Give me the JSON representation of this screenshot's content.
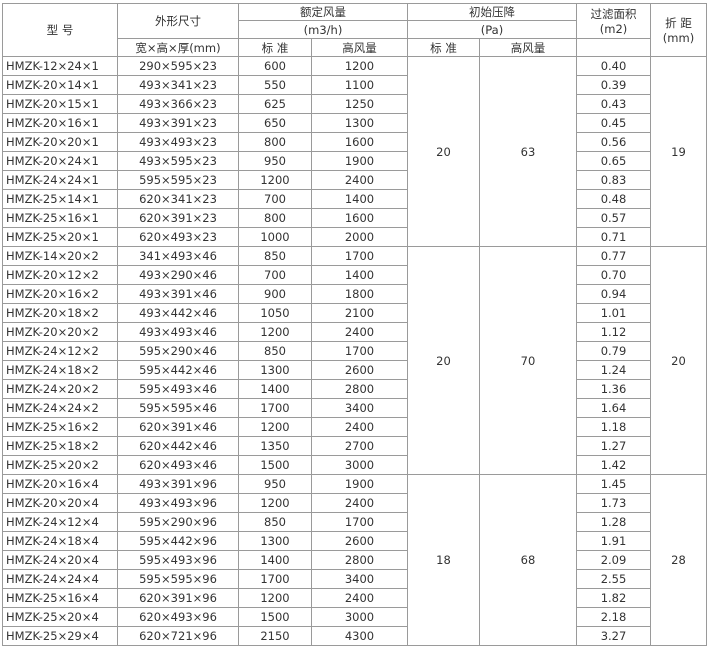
{
  "headers": {
    "model": "型 号",
    "dimensions": "外形尺寸",
    "dimensions_sub": "宽×高×厚(mm)",
    "airflow": "额定风量",
    "airflow_unit": "(m3/h)",
    "pressure": "初始压降",
    "pressure_unit": "(Pa)",
    "standard": "标 准",
    "high_airflow": "高风量",
    "area": "过滤面积",
    "area_unit": "(m2)",
    "pitch": "折 距",
    "pitch_unit": "(mm)"
  },
  "groups": [
    {
      "pressure_std": "20",
      "pressure_high": "63",
      "pitch": "19",
      "rows": [
        {
          "model": "HMZK-12×24×1",
          "size": "290×595×23",
          "std": "600",
          "high": "1200",
          "area": "0.40"
        },
        {
          "model": "HMZK-20×14×1",
          "size": "493×341×23",
          "std": "550",
          "high": "1100",
          "area": "0.39"
        },
        {
          "model": "HMZK-20×15×1",
          "size": "493×366×23",
          "std": "625",
          "high": "1250",
          "area": "0.43"
        },
        {
          "model": "HMZK-20×16×1",
          "size": "493×391×23",
          "std": "650",
          "high": "1300",
          "area": "0.45"
        },
        {
          "model": "HMZK-20×20×1",
          "size": "493×493×23",
          "std": "800",
          "high": "1600",
          "area": "0.56"
        },
        {
          "model": "HMZK-20×24×1",
          "size": "493×595×23",
          "std": "950",
          "high": "1900",
          "area": "0.65"
        },
        {
          "model": "HMZK-24×24×1",
          "size": "595×595×23",
          "std": "1200",
          "high": "2400",
          "area": "0.83"
        },
        {
          "model": "HMZK-25×14×1",
          "size": "620×341×23",
          "std": "700",
          "high": "1400",
          "area": "0.48"
        },
        {
          "model": "HMZK-25×16×1",
          "size": "620×391×23",
          "std": "800",
          "high": "1600",
          "area": "0.57"
        },
        {
          "model": "HMZK-25×20×1",
          "size": "620×493×23",
          "std": "1000",
          "high": "2000",
          "area": "0.71"
        }
      ]
    },
    {
      "pressure_std": "20",
      "pressure_high": "70",
      "pitch": "20",
      "rows": [
        {
          "model": "HMZK-14×20×2",
          "size": "341×493×46",
          "std": "850",
          "high": "1700",
          "area": "0.77"
        },
        {
          "model": "HMZK-20×12×2",
          "size": "493×290×46",
          "std": "700",
          "high": "1400",
          "area": "0.70"
        },
        {
          "model": "HMZK-20×16×2",
          "size": "493×391×46",
          "std": "900",
          "high": "1800",
          "area": "0.94"
        },
        {
          "model": "HMZK-20×18×2",
          "size": "493×442×46",
          "std": "1050",
          "high": "2100",
          "area": "1.01"
        },
        {
          "model": "HMZK-20×20×2",
          "size": "493×493×46",
          "std": "1200",
          "high": "2400",
          "area": "1.12"
        },
        {
          "model": "HMZK-24×12×2",
          "size": "595×290×46",
          "std": "850",
          "high": "1700",
          "area": "0.79"
        },
        {
          "model": "HMZK-24×18×2",
          "size": "595×442×46",
          "std": "1300",
          "high": "2600",
          "area": "1.24"
        },
        {
          "model": "HMZK-24×20×2",
          "size": "595×493×46",
          "std": "1400",
          "high": "2800",
          "area": "1.36"
        },
        {
          "model": "HMZK-24×24×2",
          "size": "595×595×46",
          "std": "1700",
          "high": "3400",
          "area": "1.64"
        },
        {
          "model": "HMZK-25×16×2",
          "size": "620×391×46",
          "std": "1200",
          "high": "2400",
          "area": "1.18"
        },
        {
          "model": "HMZK-25×18×2",
          "size": "620×442×46",
          "std": "1350",
          "high": "2700",
          "area": "1.27"
        },
        {
          "model": "HMZK-25×20×2",
          "size": "620×493×46",
          "std": "1500",
          "high": "3000",
          "area": "1.42"
        }
      ]
    },
    {
      "pressure_std": "18",
      "pressure_high": "68",
      "pitch": "28",
      "rows": [
        {
          "model": "HMZK-20×16×4",
          "size": "493×391×96",
          "std": "950",
          "high": "1900",
          "area": "1.45"
        },
        {
          "model": "HMZK-20×20×4",
          "size": "493×493×96",
          "std": "1200",
          "high": "2400",
          "area": "1.73"
        },
        {
          "model": "HMZK-24×12×4",
          "size": "595×290×96",
          "std": "850",
          "high": "1700",
          "area": "1.28"
        },
        {
          "model": "HMZK-24×18×4",
          "size": "595×442×96",
          "std": "1300",
          "high": "2600",
          "area": "1.91"
        },
        {
          "model": "HMZK-24×20×4",
          "size": "595×493×96",
          "std": "1400",
          "high": "2800",
          "area": "2.09"
        },
        {
          "model": "HMZK-24×24×4",
          "size": "595×595×96",
          "std": "1700",
          "high": "3400",
          "area": "2.55"
        },
        {
          "model": "HMZK-25×16×4",
          "size": "620×391×96",
          "std": "1200",
          "high": "2400",
          "area": "1.82"
        },
        {
          "model": "HMZK-25×20×4",
          "size": "620×493×96",
          "std": "1500",
          "high": "3000",
          "area": "2.18"
        },
        {
          "model": "HMZK-25×29×4",
          "size": "620×721×96",
          "std": "2150",
          "high": "4300",
          "area": "3.27"
        }
      ]
    }
  ]
}
